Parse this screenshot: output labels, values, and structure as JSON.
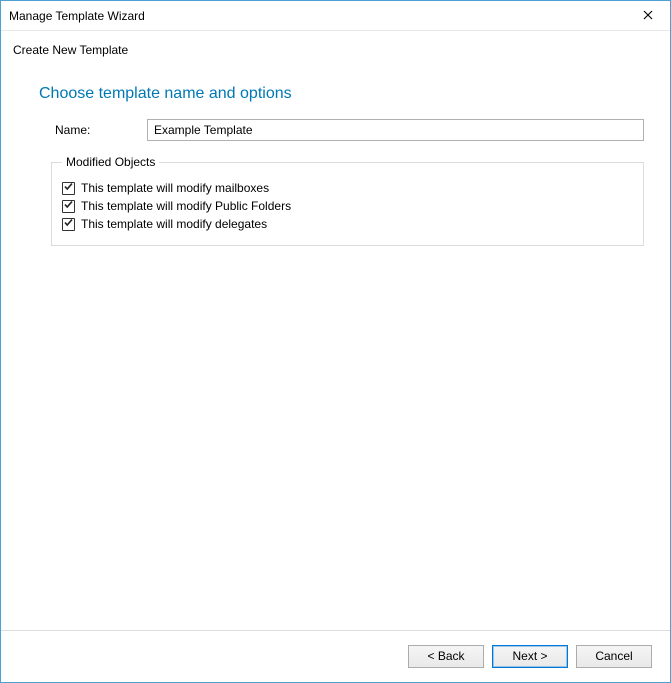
{
  "window": {
    "title": "Manage Template Wizard"
  },
  "subtitle": "Create New Template",
  "heading": "Choose template name and options",
  "form": {
    "name_label": "Name:",
    "name_value": "Example Template"
  },
  "fieldset": {
    "legend": "Modified Objects",
    "items": [
      {
        "label": "This template will modify mailboxes",
        "checked": true
      },
      {
        "label": "This template will modify Public Folders",
        "checked": true
      },
      {
        "label": "This template will modify delegates",
        "checked": true
      }
    ]
  },
  "footer": {
    "back": "< Back",
    "next": "Next >",
    "cancel": "Cancel"
  }
}
